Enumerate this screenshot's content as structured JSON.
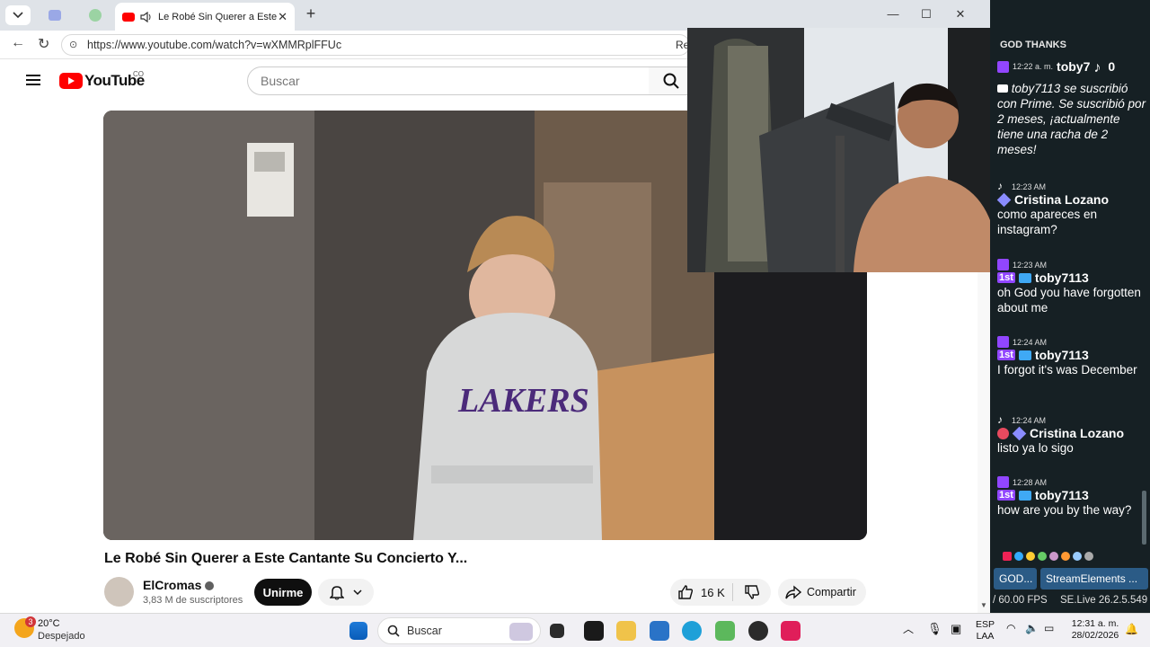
{
  "browser": {
    "tab_title": "Le Robé Sin Querer a Este Cantante Su Concierto Y...",
    "url": "https://www.youtube.com/watch?v=wXMMRplFFUc",
    "url_suffix": "Re"
  },
  "youtube": {
    "logo_text": "YouTube",
    "country": "CO",
    "search_placeholder": "Buscar",
    "video_title": "Le Robé Sin Querer a Este Cantante Su Concierto Y...",
    "channel_name": "ElCromas",
    "subscribers": "3,83 M de suscriptores",
    "join_label": "Unirme",
    "likes": "16 K",
    "share_label": "Compartir",
    "jersey_text": "LAKERS"
  },
  "chat": {
    "header": "GOD THANKS",
    "top_user": "toby7",
    "top_count": "0",
    "messages": [
      {
        "time": "12:22 a. m.",
        "user": "toby7113",
        "text": "toby7113 se suscribió con Prime. Se suscribió por 2 meses, ¡actualmente tiene una racha de 2 meses!"
      },
      {
        "time": "12:23 AM",
        "user": "Cristina Lozano",
        "text": "como apareces en instagram?"
      },
      {
        "time": "12:23 AM",
        "user": "toby7113",
        "text": "oh God you have forgotten about me"
      },
      {
        "time": "12:24 AM",
        "user": "toby7113",
        "text": "I forgot it's was December"
      },
      {
        "time": "12:24 AM",
        "user": "Cristina Lozano",
        "text": "listo ya lo sigo"
      },
      {
        "time": "12:28 AM",
        "user": "toby7113",
        "text": "how are you by the way?"
      }
    ],
    "tabs": [
      "GOD...",
      "StreamElements ..."
    ],
    "fps": "/ 60.00 FPS",
    "version": "SE.Live 26.2.5.549"
  },
  "taskbar": {
    "weather_temp": "20°C",
    "weather_desc": "Despejado",
    "weather_badge": "3",
    "search_label": "Buscar",
    "lang1": "ESP",
    "lang2": "LAA",
    "time": "12:31 a. m.",
    "date": "28/02/2026"
  }
}
